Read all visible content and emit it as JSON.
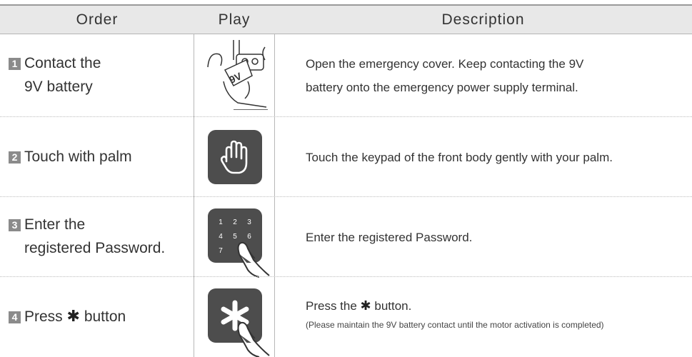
{
  "header": {
    "order": "Order",
    "play": "Play",
    "description": "Description"
  },
  "rows": [
    {
      "number": "1",
      "order_line1": "Contact the",
      "order_line2": "9V battery",
      "play_icon": "battery-contact-illustration",
      "play_text": "9V",
      "desc_line1": "Open the emergency cover. Keep contacting the 9V",
      "desc_line2": "battery onto the emergency power supply terminal."
    },
    {
      "number": "2",
      "order_line1": "Touch with palm",
      "play_icon": "palm-icon",
      "desc_line1": "Touch the keypad of the front body gently with your palm."
    },
    {
      "number": "3",
      "order_line1": "Enter the",
      "order_line2": "registered Password.",
      "play_icon": "keypad-icon",
      "keypad_keys": [
        "1",
        "2",
        "3",
        "4",
        "5",
        "6",
        "7"
      ],
      "desc_line1": "Enter the registered Password."
    },
    {
      "number": "4",
      "order_prefix": "Press",
      "order_symbol": "✱",
      "order_suffix": "button",
      "play_icon": "asterisk-key-icon",
      "desc_prefix": "Press the",
      "desc_symbol": "✱",
      "desc_suffix": "button.",
      "desc_note": "(Please maintain the 9V battery contact until the motor activation is completed)"
    }
  ],
  "colors": {
    "header_bg": "#e8e8e8",
    "icon_tile": "#4d4d4d",
    "number_badge": "#8b8b8b",
    "text": "#333333"
  }
}
